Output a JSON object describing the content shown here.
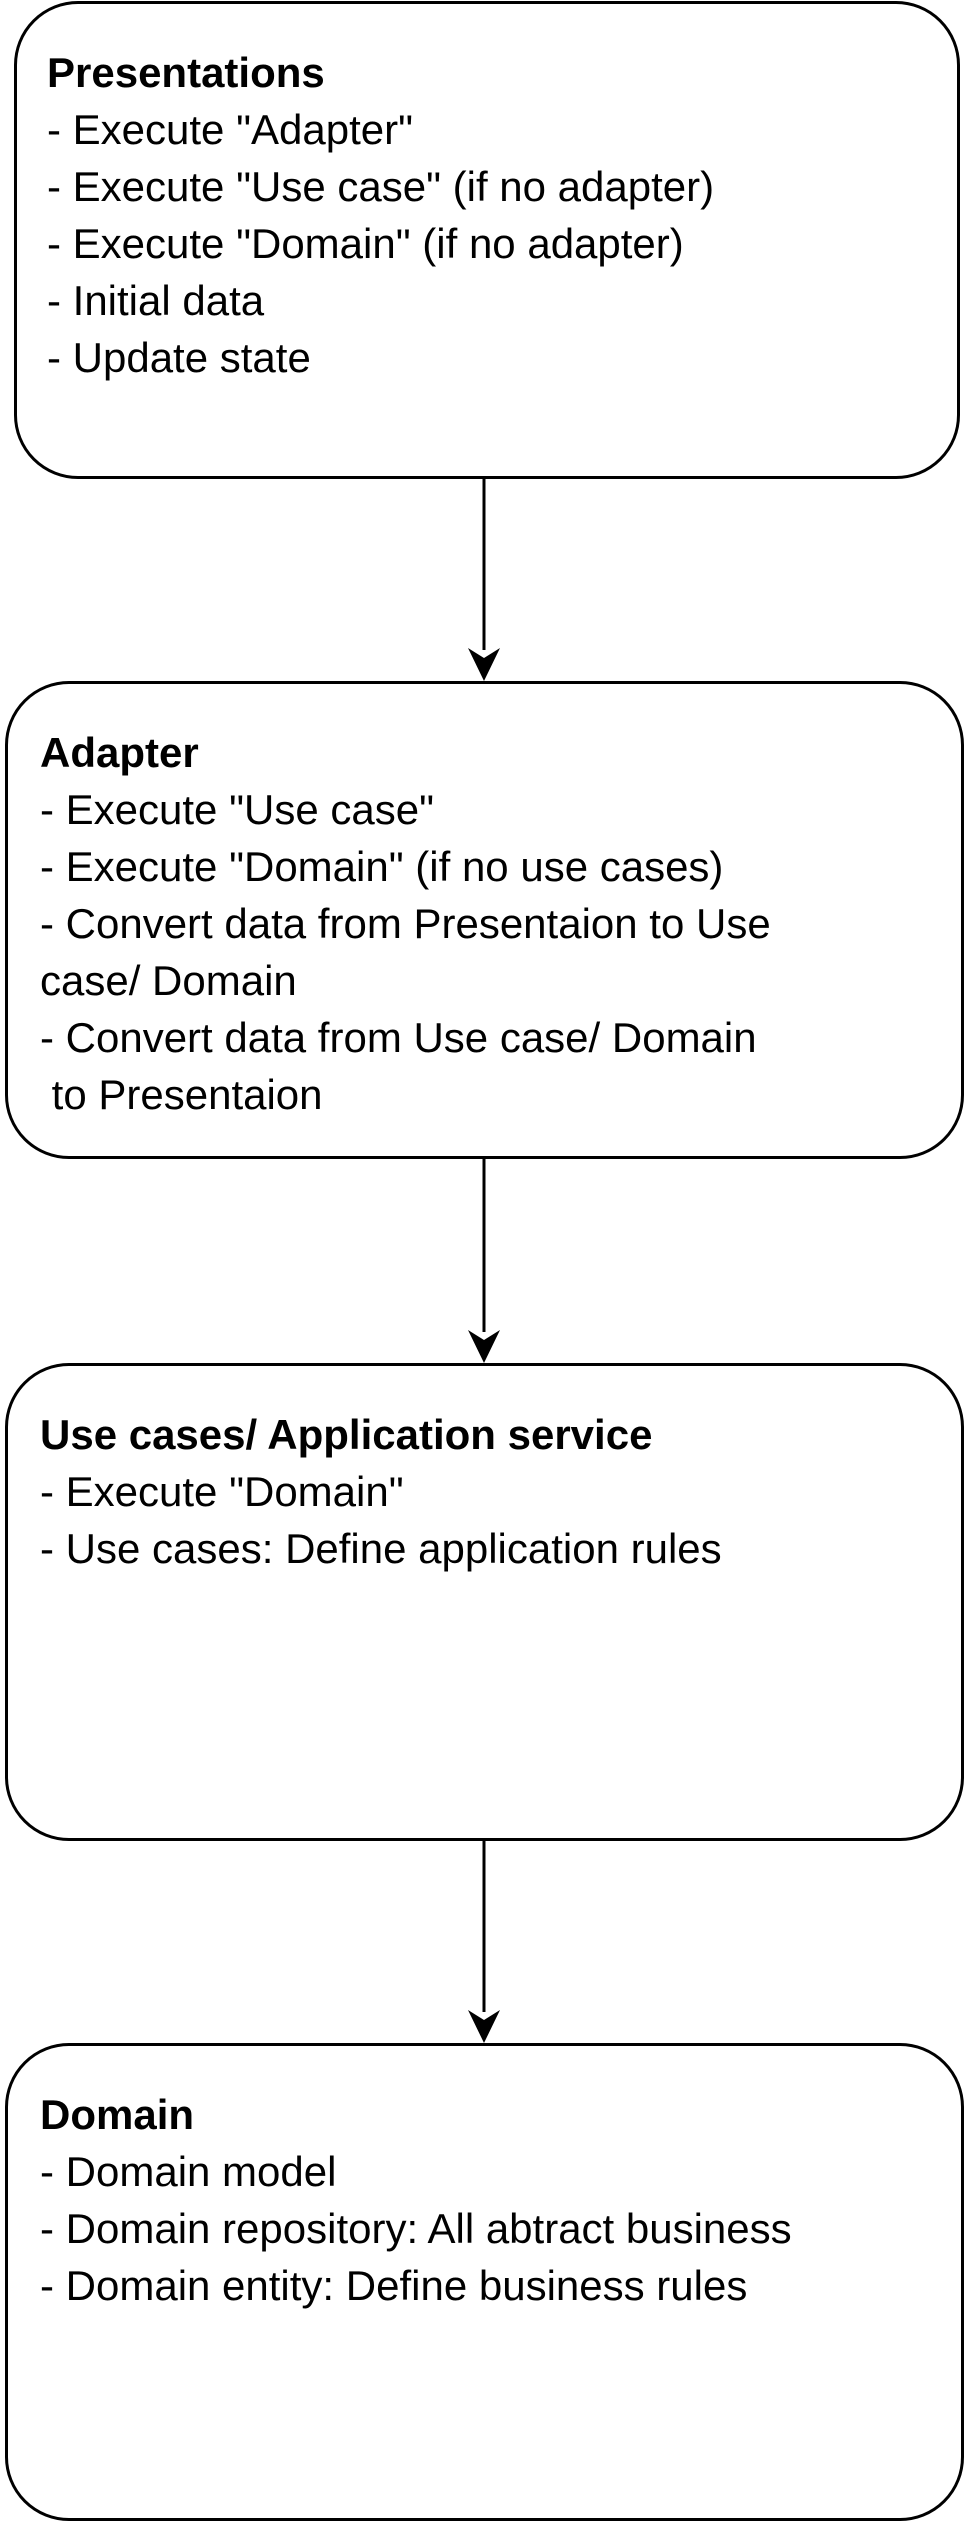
{
  "boxes": [
    {
      "title": "Presentations",
      "lines": [
        "- Execute \"Adapter\"",
        "- Execute \"Use case\" (if no adapter)",
        "- Execute \"Domain\" (if no adapter)",
        "- Initial data",
        "- Update state"
      ]
    },
    {
      "title": "Adapter",
      "lines": [
        "- Execute \"Use case\"",
        "- Execute \"Domain\" (if no use cases)",
        "- Convert data from Presentaion to Use",
        "case/ Domain",
        "- Convert data from Use case/ Domain",
        " to Presentaion"
      ]
    },
    {
      "title": "Use cases/ Application service",
      "lines": [
        "- Execute \"Domain\"",
        "- Use cases: Define application rules"
      ]
    },
    {
      "title": "Domain",
      "lines": [
        "- Domain model",
        "- Domain repository: All abtract business",
        "- Domain entity: Define business rules"
      ]
    }
  ]
}
